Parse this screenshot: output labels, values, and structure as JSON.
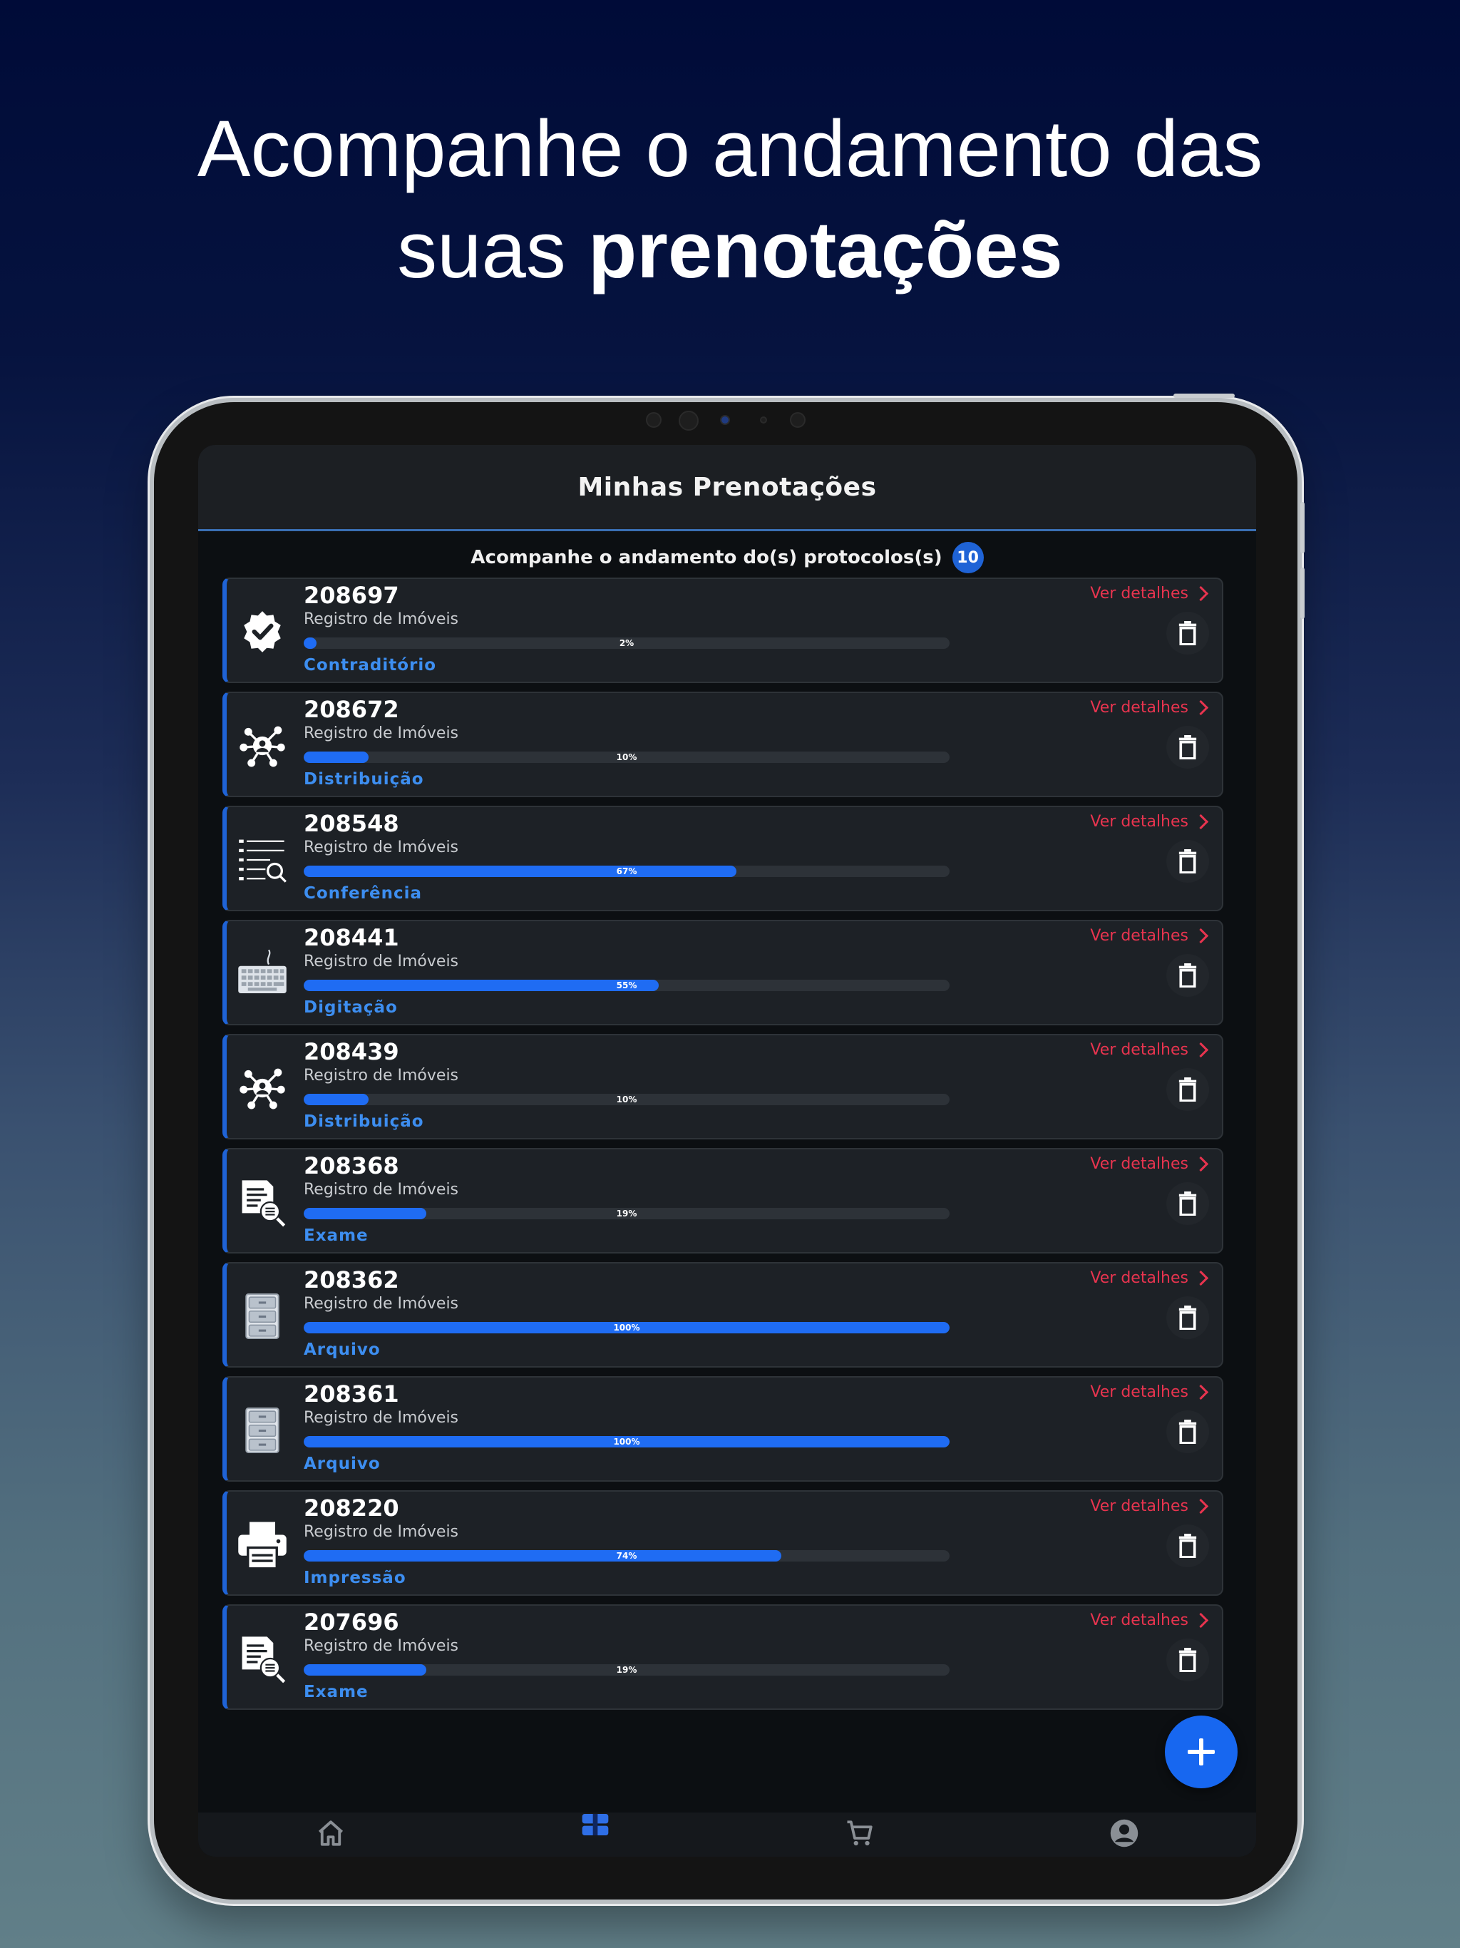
{
  "headline": {
    "line1": "Acompanhe o andamento das",
    "line2_regular": "suas ",
    "line2_bold": "prenotações"
  },
  "appbar": {
    "title": "Minhas Prenotações"
  },
  "subhead": {
    "text": "Acompanhe o andamento do(s) protocolos(s)",
    "count": "10"
  },
  "link_label": "Ver detalhes",
  "colors": {
    "accent": "#1f63d6",
    "link": "#e8344f",
    "stage": "#3d8ef0",
    "background_top": "#000b38"
  },
  "protocols": [
    {
      "number": "208697",
      "type": "Registro de Imóveis",
      "progress": 2,
      "progress_label": "2%",
      "stage": "Contraditório",
      "icon": "verified-badge-icon"
    },
    {
      "number": "208672",
      "type": "Registro de Imóveis",
      "progress": 10,
      "progress_label": "10%",
      "stage": "Distribuição",
      "icon": "distribution-network-icon"
    },
    {
      "number": "208548",
      "type": "Registro de Imóveis",
      "progress": 67,
      "progress_label": "67%",
      "stage": "Conferência",
      "icon": "list-search-icon"
    },
    {
      "number": "208441",
      "type": "Registro de Imóveis",
      "progress": 55,
      "progress_label": "55%",
      "stage": "Digitação",
      "icon": "keyboard-icon"
    },
    {
      "number": "208439",
      "type": "Registro de Imóveis",
      "progress": 10,
      "progress_label": "10%",
      "stage": "Distribuição",
      "icon": "distribution-network-icon"
    },
    {
      "number": "208368",
      "type": "Registro de Imóveis",
      "progress": 19,
      "progress_label": "19%",
      "stage": "Exame",
      "icon": "document-search-icon"
    },
    {
      "number": "208362",
      "type": "Registro de Imóveis",
      "progress": 100,
      "progress_label": "100%",
      "stage": "Arquivo",
      "icon": "file-cabinet-icon"
    },
    {
      "number": "208361",
      "type": "Registro de Imóveis",
      "progress": 100,
      "progress_label": "100%",
      "stage": "Arquivo",
      "icon": "file-cabinet-icon"
    },
    {
      "number": "208220",
      "type": "Registro de Imóveis",
      "progress": 74,
      "progress_label": "74%",
      "stage": "Impressão",
      "icon": "printer-icon"
    },
    {
      "number": "207696",
      "type": "Registro de Imóveis",
      "progress": 19,
      "progress_label": "19%",
      "stage": "Exame",
      "icon": "document-search-icon"
    }
  ],
  "bottom_nav": [
    {
      "icon": "home-icon"
    },
    {
      "icon": "protocols-icon"
    },
    {
      "icon": "cart-icon"
    },
    {
      "icon": "account-icon"
    }
  ]
}
